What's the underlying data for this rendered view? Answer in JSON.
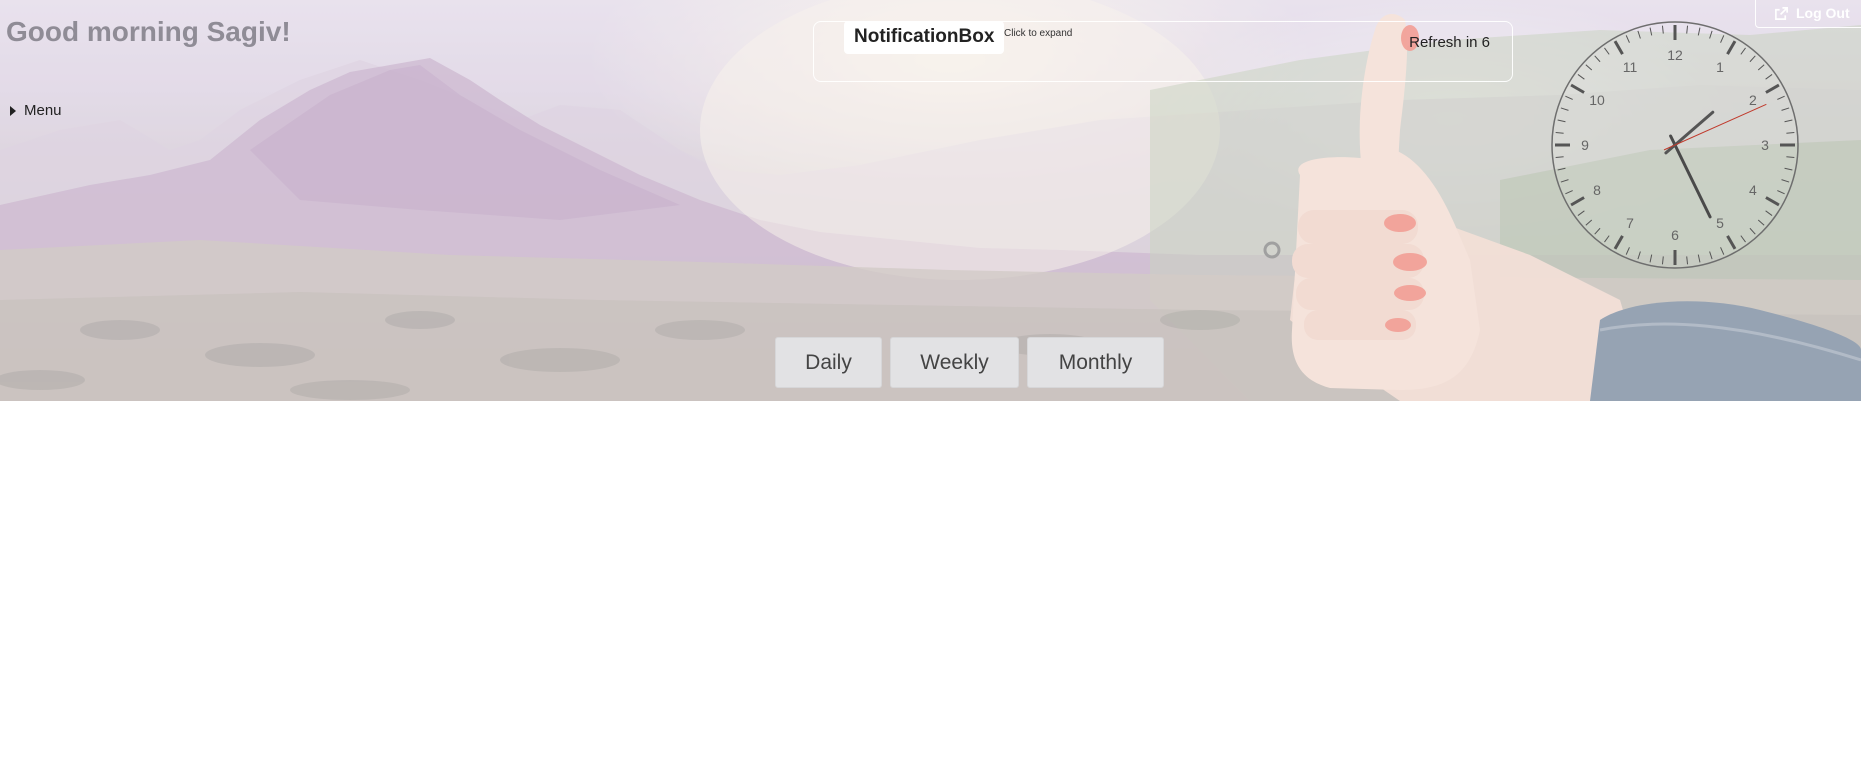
{
  "header": {
    "greeting": "Good morning Sagiv!",
    "menu_label": "Menu",
    "logout_label": "Log Out"
  },
  "notification_box": {
    "title": "NotificationBox",
    "hint": "Click to expand",
    "refresh_text": "Refresh in 6"
  },
  "clock": {
    "numerals": [
      "12",
      "1",
      "2",
      "3",
      "4",
      "5",
      "6",
      "7",
      "8",
      "9",
      "10",
      "11"
    ],
    "hour": 5,
    "minute": 8,
    "second": 11
  },
  "period_tabs": {
    "daily": "Daily",
    "weekly": "Weekly",
    "monthly": "Monthly"
  },
  "colors": {
    "greeting_text": "#8f8c96",
    "button_bg": "#e2e2e4",
    "second_hand": "#c0392b"
  },
  "icons": {
    "menu_toggle": "caret-right-icon",
    "logout": "external-link-icon"
  }
}
